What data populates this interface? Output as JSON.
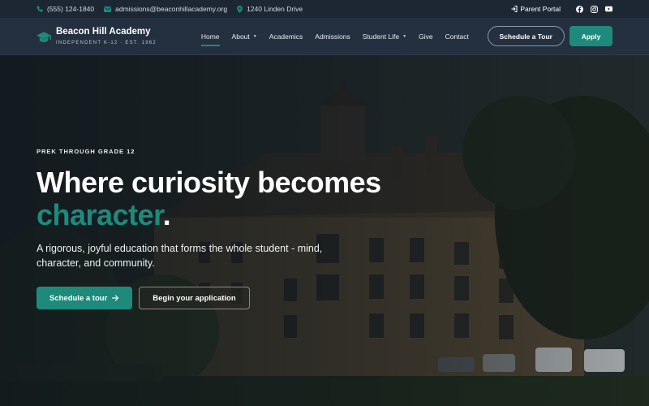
{
  "topbar": {
    "phone": "(555) 124-1840",
    "email": "admissions@beaconhillacademy.org",
    "address": "1240 Linden Drive",
    "portal_label": "Parent Portal",
    "socials": [
      "facebook-icon",
      "instagram-icon",
      "youtube-icon"
    ]
  },
  "brand": {
    "name": "Beacon Hill Academy",
    "tagline": "INDEPENDENT K-12 · EST. 1962"
  },
  "nav": {
    "items": [
      {
        "label": "Home",
        "active": true,
        "dropdown": false
      },
      {
        "label": "About",
        "active": false,
        "dropdown": true
      },
      {
        "label": "Academics",
        "active": false,
        "dropdown": false
      },
      {
        "label": "Admissions",
        "active": false,
        "dropdown": false
      },
      {
        "label": "Student Life",
        "active": false,
        "dropdown": true
      },
      {
        "label": "Give",
        "active": false,
        "dropdown": false
      },
      {
        "label": "Contact",
        "active": false,
        "dropdown": false
      }
    ],
    "schedule_label": "Schedule a Tour",
    "apply_label": "Apply"
  },
  "hero": {
    "eyebrow": "PREK THROUGH GRADE 12",
    "headline_line1": "Where curiosity becomes",
    "headline_accent": "character",
    "headline_period": ".",
    "lede": "A rigorous, joyful education that forms the whole student - mind, character, and community.",
    "cta_primary": "Schedule a tour",
    "cta_secondary": "Begin your application"
  },
  "colors": {
    "accent": "#1e8a7c",
    "topbar_bg": "#1d2734",
    "nav_bg": "#24303f"
  }
}
